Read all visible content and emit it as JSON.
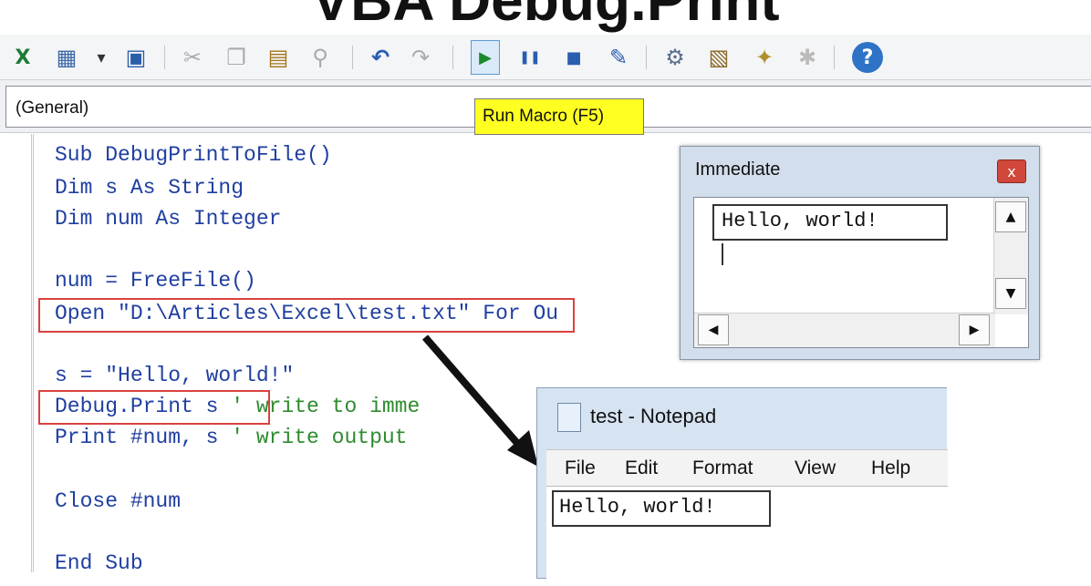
{
  "title": "VBA Debug.Print",
  "toolbar": {
    "items": [
      {
        "name": "view-excel-icon",
        "glyph": "X"
      },
      {
        "name": "insert-userform-icon",
        "glyph": "▦"
      },
      {
        "name": "dropdown-arrow-icon",
        "glyph": "▾"
      },
      {
        "name": "save-icon",
        "glyph": "▣"
      },
      {
        "name": "cut-icon",
        "glyph": "✂"
      },
      {
        "name": "copy-icon",
        "glyph": "❐"
      },
      {
        "name": "paste-icon",
        "glyph": "▤"
      },
      {
        "name": "find-icon",
        "glyph": "⚲"
      },
      {
        "name": "undo-icon",
        "glyph": "↶"
      },
      {
        "name": "redo-icon",
        "glyph": "↷"
      },
      {
        "name": "run-icon",
        "glyph": "▶"
      },
      {
        "name": "break-icon",
        "glyph": "❚❚"
      },
      {
        "name": "reset-icon",
        "glyph": "■"
      },
      {
        "name": "design-mode-icon",
        "glyph": "✎"
      },
      {
        "name": "project-explorer-icon",
        "glyph": "⚙"
      },
      {
        "name": "properties-window-icon",
        "glyph": "▧"
      },
      {
        "name": "object-browser-icon",
        "glyph": "✦"
      },
      {
        "name": "toolbox-icon",
        "glyph": "✱"
      },
      {
        "name": "help-icon",
        "glyph": "?"
      }
    ]
  },
  "object_combo": {
    "value": "(General)"
  },
  "tooltip": {
    "text": "Run Macro (F5)"
  },
  "code": {
    "line1": "Sub DebugPrintToFile()",
    "line2": "Dim s As String",
    "line3": "Dim num As Integer",
    "line4": "num = FreeFile()",
    "line5a": "Open \"D:\\Articles\\Excel\\test.txt\"",
    "line5b": " For Ou",
    "line6": "s = \"Hello, world!\"",
    "line7a": "Debug.Print s",
    "line7b": " ' write to imme",
    "line8a": "Print #num, s",
    "line8b": " ' write output",
    "line9": "Close #num",
    "line10": "End Sub"
  },
  "immediate": {
    "title": "Immediate",
    "output": "Hello, world!",
    "close_glyph": "x"
  },
  "notepad": {
    "title": "test - Notepad",
    "menu": [
      "File",
      "Edit",
      "Format",
      "View",
      "Help"
    ],
    "content": "Hello, world!"
  },
  "colors": {
    "keyword": "#1f3fa0",
    "comment": "#2e8b2e",
    "highlight_box": "#d9423f",
    "tooltip_bg": "#ffff22"
  }
}
